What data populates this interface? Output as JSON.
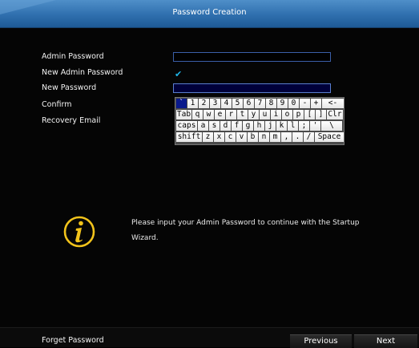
{
  "window": {
    "title": "Password Creation"
  },
  "form": {
    "admin_password_label": "Admin Password",
    "new_admin_password_label": "New Admin Password",
    "new_password_label": "New Password",
    "confirm_label": "Confirm",
    "recovery_email_label": "Recovery Email",
    "new_admin_password_checked": true
  },
  "keyboard": {
    "rows": [
      [
        "`",
        "1",
        "2",
        "3",
        "4",
        "5",
        "6",
        "7",
        "8",
        "9",
        "0",
        "-",
        "+",
        "<-"
      ],
      [
        "Tab",
        "q",
        "w",
        "e",
        "r",
        "t",
        "y",
        "u",
        "i",
        "o",
        "p",
        "[",
        "]",
        "Clr"
      ],
      [
        "caps",
        "a",
        "s",
        "d",
        "f",
        "g",
        "h",
        "j",
        "k",
        "l",
        ";",
        "'",
        "\\"
      ],
      [
        "shift",
        "z",
        "x",
        "c",
        "v",
        "b",
        "n",
        "m",
        ",",
        ".",
        "/",
        "Space"
      ]
    ]
  },
  "info": {
    "message": "Please input your Admin Password to continue with the Startup Wizard."
  },
  "footer": {
    "forget_password": "Forget Password",
    "previous": "Previous",
    "next": "Next"
  },
  "colors": {
    "title_bar": "#2f6fae",
    "field_border": "#3b5fa8",
    "check": "#1fb5e8",
    "info_icon": "#f2c31b"
  }
}
